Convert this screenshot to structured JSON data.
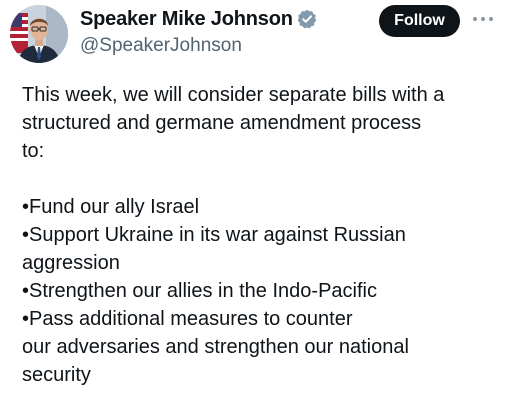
{
  "author": {
    "display_name": "Speaker Mike Johnson",
    "handle": "@SpeakerJohnson",
    "verified_badge_icon": "verified-badge-icon",
    "avatar_icon": "profile-photo"
  },
  "actions": {
    "follow_label": "Follow",
    "more_icon": "more-options-icon"
  },
  "post": {
    "intro": "This week, we will consider separate bills with a\nstructured and germane amendment process\nto:",
    "bullets": [
      "•Fund our ally Israel",
      "•Support Ukraine in its war against Russian\naggression",
      "•Strengthen our allies in the Indo-Pacific",
      "•Pass additional measures to counter\nour adversaries and strengthen our national\nsecurity"
    ]
  },
  "colors": {
    "text": "#0f1419",
    "secondary_text": "#536471",
    "follow_bg": "#0f1419",
    "verified": "#829aab"
  }
}
